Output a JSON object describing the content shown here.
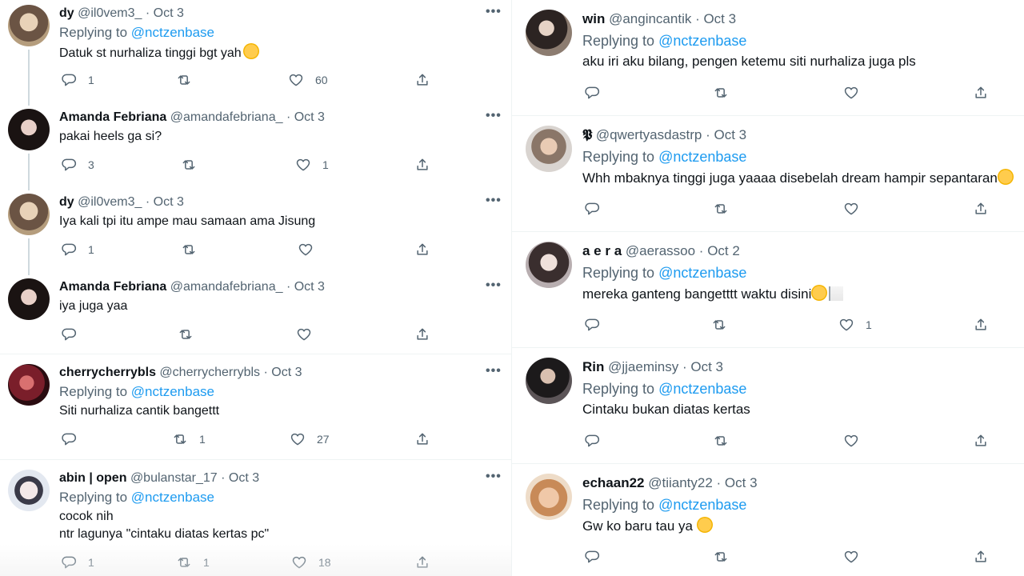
{
  "left": {
    "tweets": [
      {
        "name": "dy",
        "handle": "@il0vem3_ · Oct 3",
        "replying_prefix": "Replying to ",
        "replying_to": "@nctzenbase",
        "text": "Datuk st nurhaliza tinggi bgt yah",
        "emoji": "slightly-smiling-face",
        "replies": "1",
        "retweets": "",
        "likes": "60",
        "avatar_color": "#c9a77f"
      },
      {
        "name": "Amanda Febriana",
        "handle": "@amandafebriana_ · Oct 3",
        "replying_prefix": "",
        "replying_to": "",
        "text": "pakai heels ga si?",
        "replies": "3",
        "retweets": "",
        "likes": "1",
        "avatar_color": "#2a1e1c"
      },
      {
        "name": "dy",
        "handle": "@il0vem3_ · Oct 3",
        "replying_prefix": "",
        "replying_to": "",
        "text": "Iya kali tpi itu ampe mau samaan ama Jisung",
        "replies": "1",
        "retweets": "",
        "likes": "",
        "avatar_color": "#c9a77f"
      },
      {
        "name": "Amanda Febriana",
        "handle": "@amandafebriana_ · Oct 3",
        "replying_prefix": "",
        "replying_to": "",
        "text": "iya juga yaa",
        "replies": "",
        "retweets": "",
        "likes": "",
        "avatar_color": "#2a1e1c"
      },
      {
        "name": "cherrycherrybls",
        "handle": "@cherrycherrybls · Oct 3",
        "replying_prefix": "Replying to ",
        "replying_to": "@nctzenbase",
        "text": "Siti nurhaliza cantik bangettt",
        "replies": "",
        "retweets": "1",
        "likes": "27",
        "avatar_color": "#8a2a2a"
      },
      {
        "name": "abin | open",
        "handle": "@bulanstar_17 · Oct 3",
        "replying_prefix": "Replying to ",
        "replying_to": "@nctzenbase",
        "text": "cocok nih\nntr lagunya \"cintaku diatas kertas pc\"",
        "replies": "1",
        "retweets": "1",
        "likes": "18",
        "avatar_color": "#d8dde6"
      }
    ]
  },
  "right": {
    "tweets": [
      {
        "name": "win",
        "handle": "@angincantik · Oct 3",
        "replying_prefix": "Replying to ",
        "replying_to": "@nctzenbase",
        "text": "aku iri aku bilang, pengen ketemu siti nurhaliza juga pls",
        "replies": "",
        "retweets": "",
        "likes": "",
        "avatar_color": "#3a3532"
      },
      {
        "name": "𝕻",
        "handle": "@qwertyasdastrp · Oct 3",
        "replying_prefix": "Replying to ",
        "replying_to": "@nctzenbase",
        "text": "Whh mbaknya tinggi juga yaaaa disebelah dream hampir sepantaran",
        "replies": "",
        "retweets": "",
        "likes": "",
        "avatar_color": "#7a6a60"
      },
      {
        "name": "a e r a",
        "handle": "@aerassoo · Oct 2",
        "replying_prefix": "Replying to ",
        "replying_to": "@nctzenbase",
        "text": "mereka ganteng bangetttt waktu disini",
        "emoji": "crying-face white-flag",
        "replies": "",
        "retweets": "",
        "likes": "1",
        "avatar_color": "#5a4a48"
      },
      {
        "name": "Rin",
        "handle": "@jjaeminsy · Oct 3",
        "replying_prefix": "Replying to ",
        "replying_to": "@nctzenbase",
        "text": "Cintaku bukan diatas kertas",
        "replies": "",
        "retweets": "",
        "likes": "",
        "avatar_color": "#2e2b2c"
      },
      {
        "name": "echaan22",
        "handle": "@tiianty22 · Oct 3",
        "replying_prefix": "Replying to ",
        "replying_to": "@nctzenbase",
        "text": "Gw ko baru tau ya ",
        "emoji": "crying-face",
        "replies": "",
        "retweets": "",
        "likes": "",
        "avatar_color": "#d6a987"
      }
    ]
  },
  "icons": {
    "reply": "reply-icon",
    "retweet": "retweet-icon",
    "like": "heart-icon",
    "share": "share-icon",
    "more": "more-icon"
  }
}
